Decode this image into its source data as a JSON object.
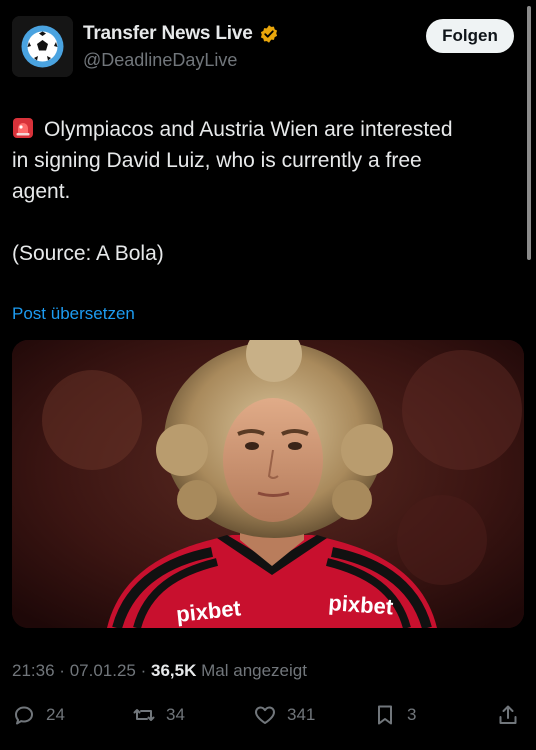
{
  "account": {
    "display_name": "Transfer News Live",
    "handle": "@DeadlineDayLive",
    "follow_label": "Folgen"
  },
  "tweet": {
    "lines": [
      "Olympiacos and Austria Wien are interested",
      "in signing David Luiz, who is currently a free",
      "agent."
    ],
    "source": "(Source: A Bola)",
    "translate_label": "Post übersetzen",
    "image_text": {
      "sponsor_left": "pixbet",
      "sponsor_right": "pixbet"
    }
  },
  "meta": {
    "time": "21:36",
    "separator": "·",
    "date": "07.01.25",
    "views": "36,5K",
    "views_label": "Mal angezeigt"
  },
  "actions": {
    "replies": "24",
    "reposts": "34",
    "likes": "341",
    "bookmarks": "3"
  },
  "colors": {
    "background": "#000000",
    "text": "#e7e9ea",
    "muted": "#71767b",
    "link": "#1d9bf0",
    "verified": "#e9a60b"
  }
}
